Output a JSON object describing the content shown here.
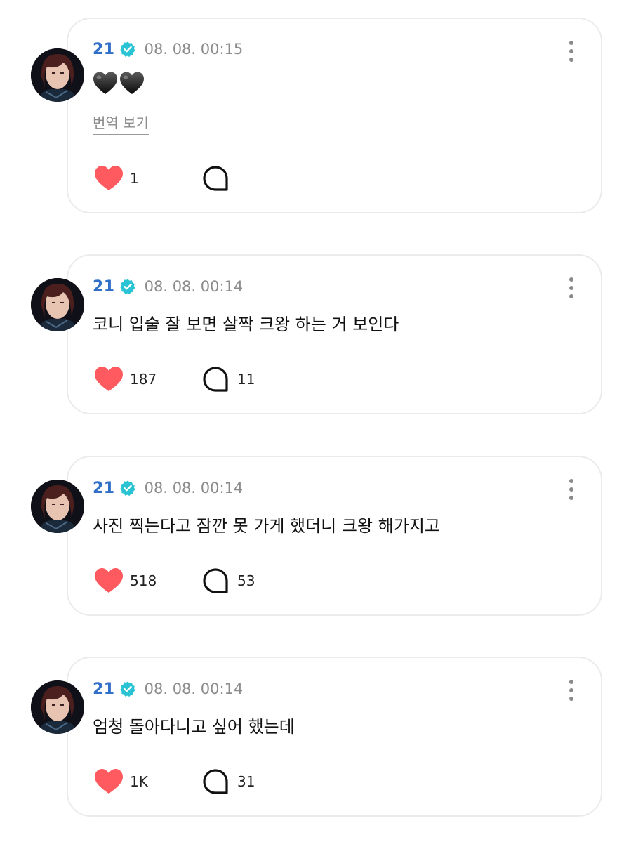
{
  "theme": {
    "author_color": "#2f6fc7",
    "verified_color": "#29c3d4",
    "heart_color": "#ff5a5f",
    "card_border": "#ebebeb"
  },
  "icons": {
    "verified": "verified-badge-icon",
    "like": "heart-icon",
    "comment": "speech-bubble-icon",
    "more": "vertical-ellipsis-icon"
  },
  "posts": [
    {
      "author": "21",
      "time": "08. 08. 00:15",
      "text": "",
      "emoji": "black-hearts",
      "translate_label": "번역 보기",
      "likes": "1",
      "comments": ""
    },
    {
      "author": "21",
      "time": "08. 08. 00:14",
      "text": "코니 입술 잘 보면 살짝 크왕 하는 거 보인다",
      "likes": "187",
      "comments": "11"
    },
    {
      "author": "21",
      "time": "08. 08. 00:14",
      "text": "사진 찍는다고 잠깐 못 가게 했더니 크왕 해가지고",
      "likes": "518",
      "comments": "53"
    },
    {
      "author": "21",
      "time": "08. 08. 00:14",
      "text": "엄청 돌아다니고 싶어 했는데",
      "likes": "1K",
      "comments": "31"
    }
  ]
}
